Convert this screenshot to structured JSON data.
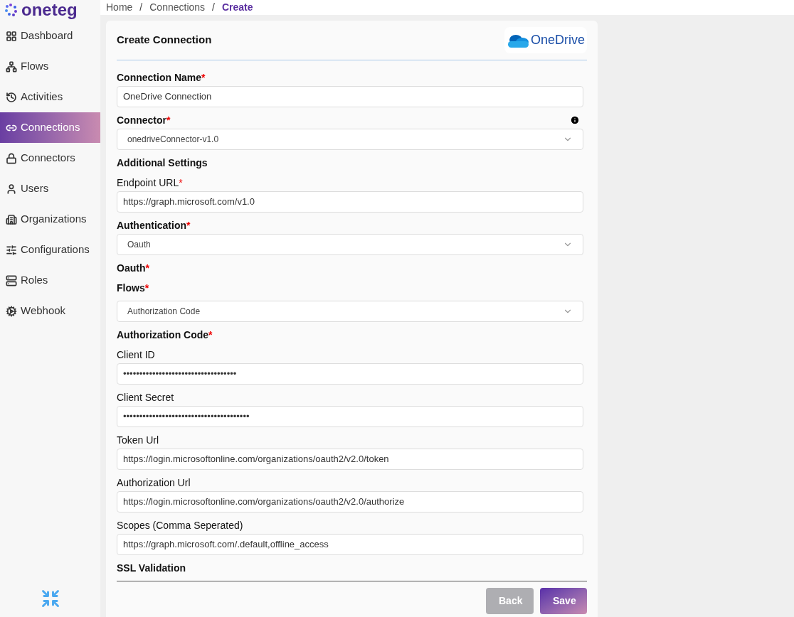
{
  "logo": {
    "text": "oneteg"
  },
  "breadcrumb": [
    {
      "label": "Home",
      "selected": false
    },
    {
      "separator": "/",
      "label": "Connections",
      "selected": false
    },
    {
      "separator": "/",
      "label": "Create",
      "selected": true
    }
  ],
  "sidebar": {
    "items": [
      {
        "label": "Dashboard",
        "selected": false
      },
      {
        "label": "Flows",
        "selected": false
      },
      {
        "label": "Activities",
        "selected": false
      },
      {
        "label": "Connections",
        "selected": true
      },
      {
        "label": "Connectors",
        "selected": false
      },
      {
        "label": "Users",
        "selected": false
      },
      {
        "label": "Organizations",
        "selected": false
      },
      {
        "label": "Configurations",
        "selected": false
      },
      {
        "label": "Roles",
        "selected": false
      },
      {
        "label": "Webhook",
        "selected": false
      }
    ]
  },
  "card": {
    "title": "Create Connection",
    "brand": "OneDrive",
    "form": [
      {
        "kind": "input",
        "label": "Connection Name",
        "bold": true,
        "mark": "*",
        "value": "OneDrive Connection"
      },
      {
        "kind": "select",
        "label": "Connector",
        "bold": true,
        "mark": "*",
        "info": true,
        "value": "onedriveConnector-v1.0"
      },
      {
        "kind": "heading",
        "label": "Additional Settings"
      },
      {
        "kind": "input",
        "label": "Endpoint URL",
        "bold": false,
        "mark": "*",
        "value": "https://graph.microsoft.com/v1.0"
      },
      {
        "kind": "select",
        "label": "Authentication",
        "bold": true,
        "mark": "*",
        "value": "Oauth"
      },
      {
        "kind": "heading",
        "label": "Oauth",
        "mark": "*"
      },
      {
        "kind": "heading",
        "label": "Flows",
        "mark": "*"
      },
      {
        "kind": "select",
        "value": "Authorization Code"
      },
      {
        "kind": "heading",
        "label": "Authorization Code",
        "mark": "*"
      },
      {
        "kind": "input",
        "label": "Client ID",
        "bold": false,
        "value": "•••••••••••••••••••••••••••••••••••"
      },
      {
        "kind": "input",
        "label": "Client Secret",
        "bold": false,
        "value": "•••••••••••••••••••••••••••••••••••••••"
      },
      {
        "kind": "input",
        "label": "Token Url",
        "bold": false,
        "value": "https://login.microsoftonline.com/organizations/oauth2/v2.0/token"
      },
      {
        "kind": "input",
        "label": "Authorization Url",
        "bold": false,
        "value": "https://login.microsoftonline.com/organizations/oauth2/v2.0/authorize"
      },
      {
        "kind": "input",
        "label": "Scopes (Comma Seperated)",
        "bold": false,
        "value": "https://graph.microsoft.com/.default,offline_access"
      },
      {
        "kind": "heading",
        "label": "SSL Validation"
      }
    ],
    "buttons": [
      {
        "label": "Back",
        "kind": "secondary"
      },
      {
        "label": "Save",
        "kind": "primary"
      }
    ]
  }
}
